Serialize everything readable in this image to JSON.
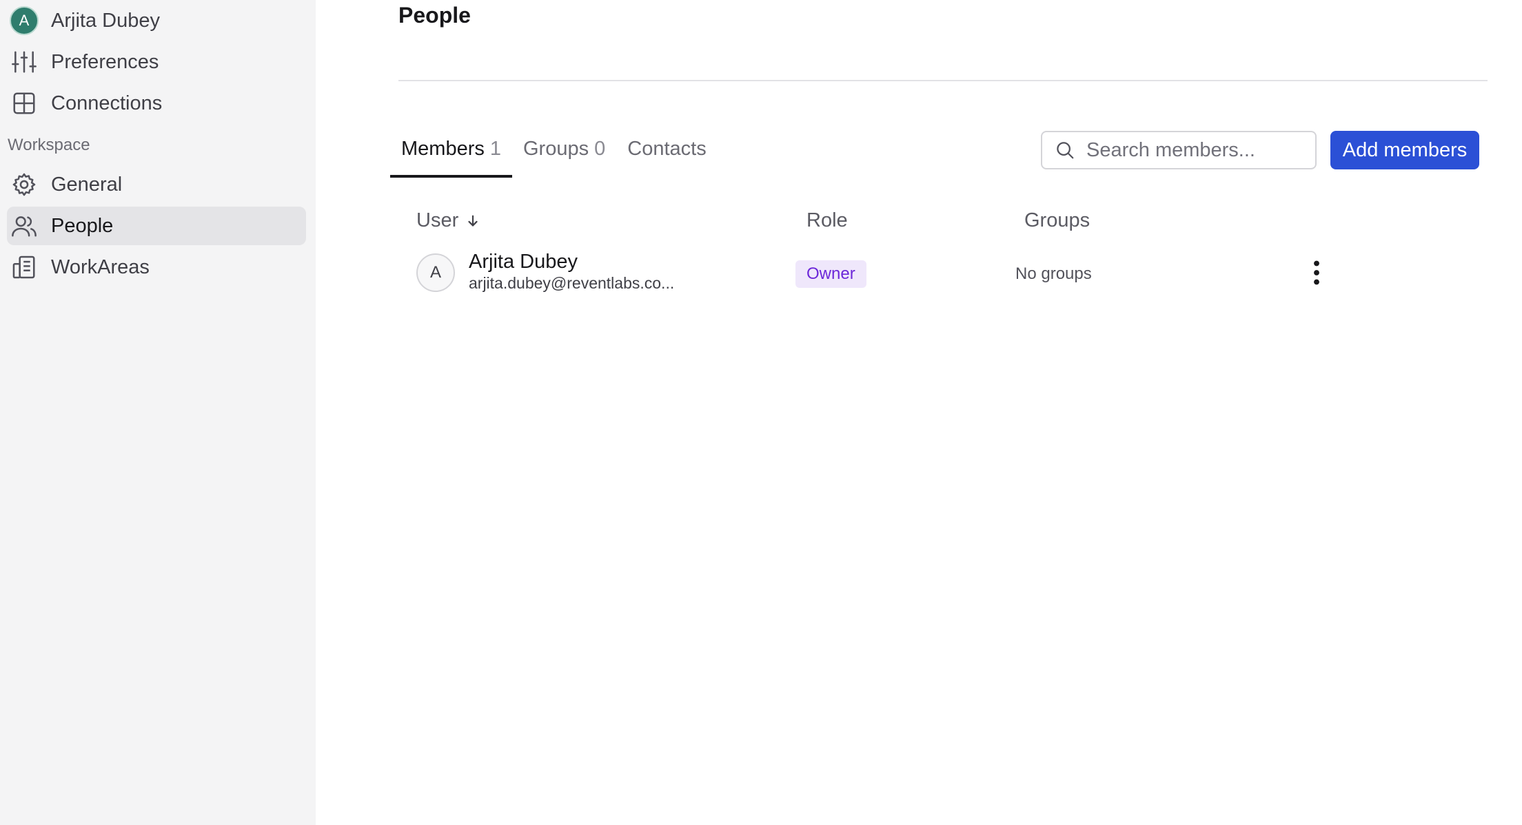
{
  "sidebar": {
    "user": {
      "avatar_letter": "A",
      "name": "Arjita Dubey"
    },
    "items_top": [
      {
        "label": "Preferences",
        "icon": "sliders-icon"
      },
      {
        "label": "Connections",
        "icon": "grid-icon"
      }
    ],
    "section_label": "Workspace",
    "items_workspace": [
      {
        "label": "General",
        "icon": "gear-icon"
      },
      {
        "label": "People",
        "icon": "people-icon",
        "active": true
      },
      {
        "label": "WorkAreas",
        "icon": "building-icon"
      }
    ]
  },
  "main": {
    "title": "People",
    "tabs": [
      {
        "label": "Members",
        "count": "1",
        "active": true
      },
      {
        "label": "Groups",
        "count": "0"
      },
      {
        "label": "Contacts",
        "count": ""
      }
    ],
    "search": {
      "placeholder": "Search members...",
      "value": ""
    },
    "add_button": "Add members",
    "table": {
      "headers": {
        "user": "User",
        "role": "Role",
        "groups": "Groups"
      },
      "rows": [
        {
          "avatar_letter": "A",
          "name": "Arjita Dubey",
          "email": "arjita.dubey@reventlabs.co...",
          "role": "Owner",
          "groups": "No groups"
        }
      ]
    }
  },
  "colors": {
    "accent": "#2b50d6",
    "sidebar_bg": "#f4f4f5",
    "active_item_bg": "#e4e4e7",
    "owner_badge_bg": "#efe7fb",
    "owner_badge_text": "#6d28d9",
    "user_avatar_bg": "#2f7d6d"
  }
}
